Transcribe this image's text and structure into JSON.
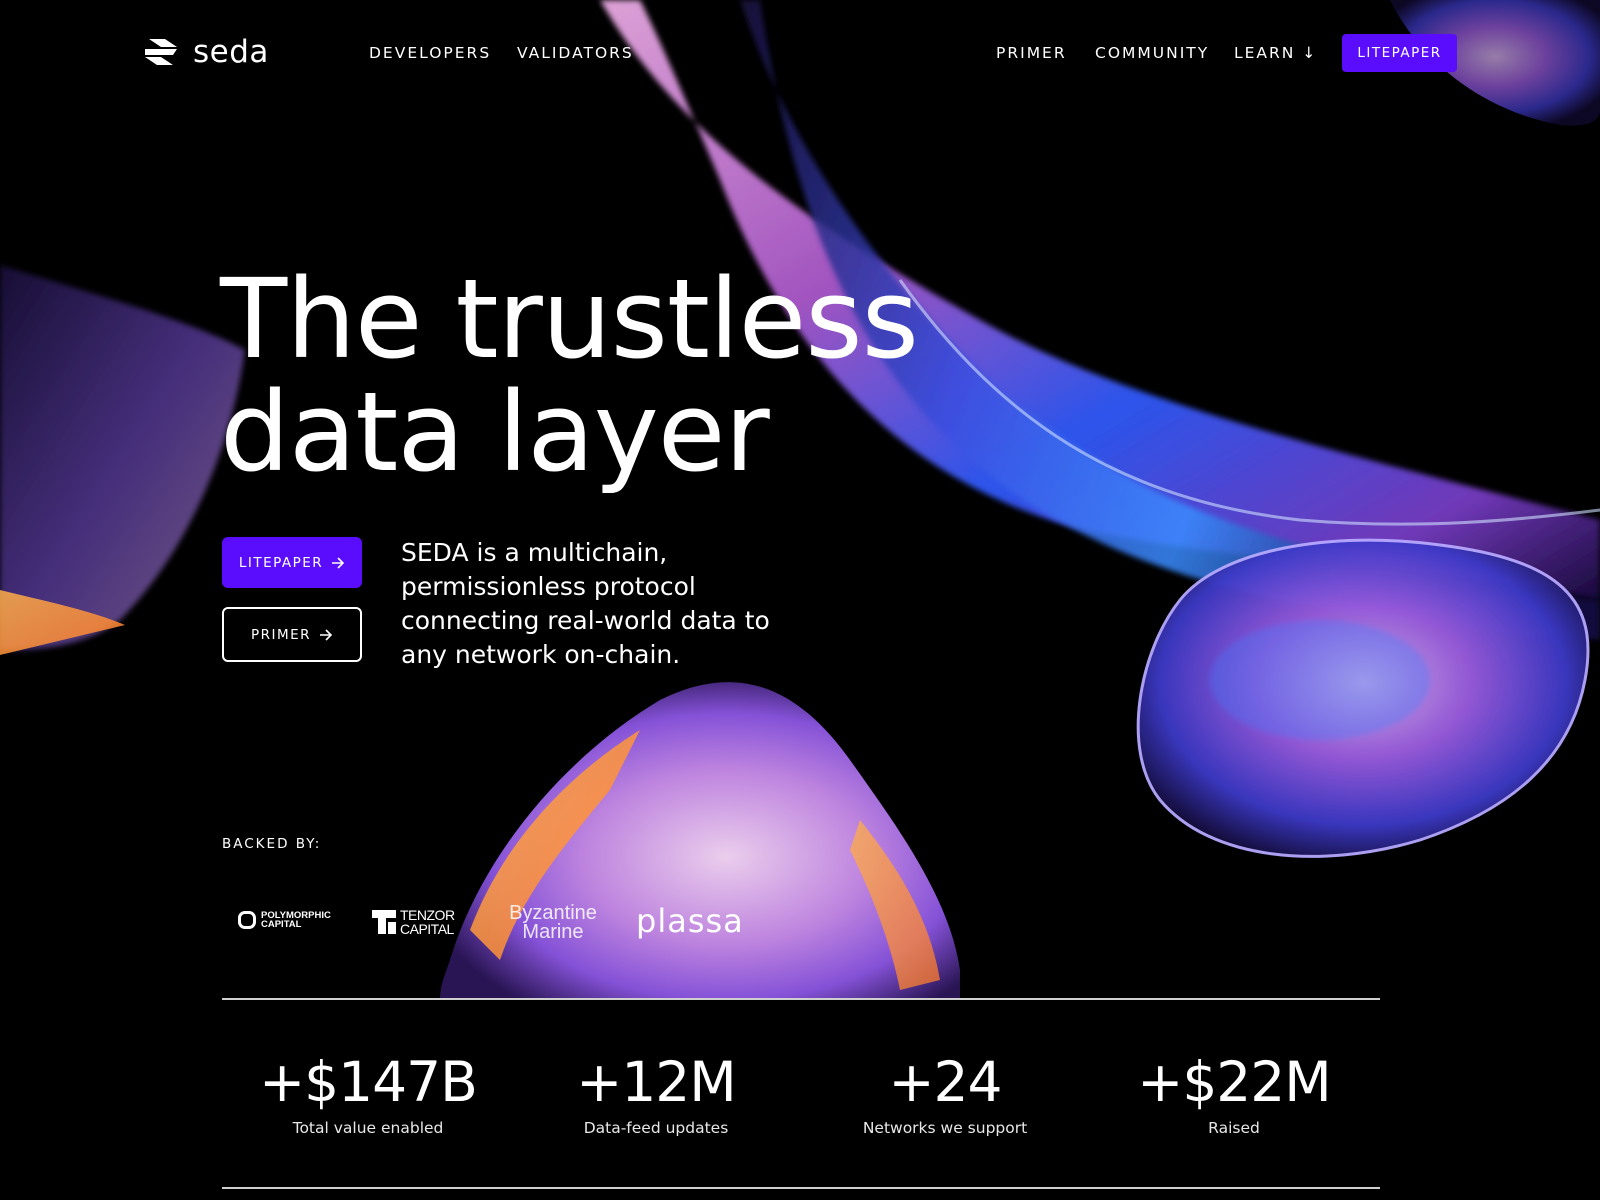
{
  "nav": {
    "logo_text": "seda",
    "links": [
      "DEVELOPERS",
      "VALIDATORS",
      "PRIMER",
      "COMMUNITY",
      "LEARN ↓"
    ],
    "cta_label": "LITEPAPER"
  },
  "hero": {
    "title_line1": "The trustless",
    "title_line2": "data layer",
    "description": "SEDA is a multichain, permissionless protocol connecting real-world data to any network on-chain.",
    "primary_button": "LITEPAPER",
    "secondary_button": "PRIMER"
  },
  "backers": {
    "label": "BACKED BY:",
    "logos": [
      {
        "name": "POLYMORPHIC CAPITAL",
        "line1": "POLYMORPHIC",
        "line2": "CAPITAL"
      },
      {
        "name": "TENZOR CAPITAL",
        "line1": "TENZOR",
        "line2": "CAPITAL"
      },
      {
        "name": "Byzantine Marine",
        "line1": "Byzantine",
        "line2": "Marine"
      },
      {
        "name": "plassa"
      }
    ]
  },
  "stats": [
    {
      "value": "+$147B",
      "label": "Total value enabled"
    },
    {
      "value": "+12M",
      "label": "Data-feed updates"
    },
    {
      "value": "+24",
      "label": "Networks we support"
    },
    {
      "value": "+$22M",
      "label": "Raised"
    }
  ],
  "colors": {
    "background": "#000000",
    "accent": "#5a0cfc",
    "text": "#ffffff"
  },
  "icons": [
    "seda-logo-icon",
    "arrow-right-icon"
  ]
}
